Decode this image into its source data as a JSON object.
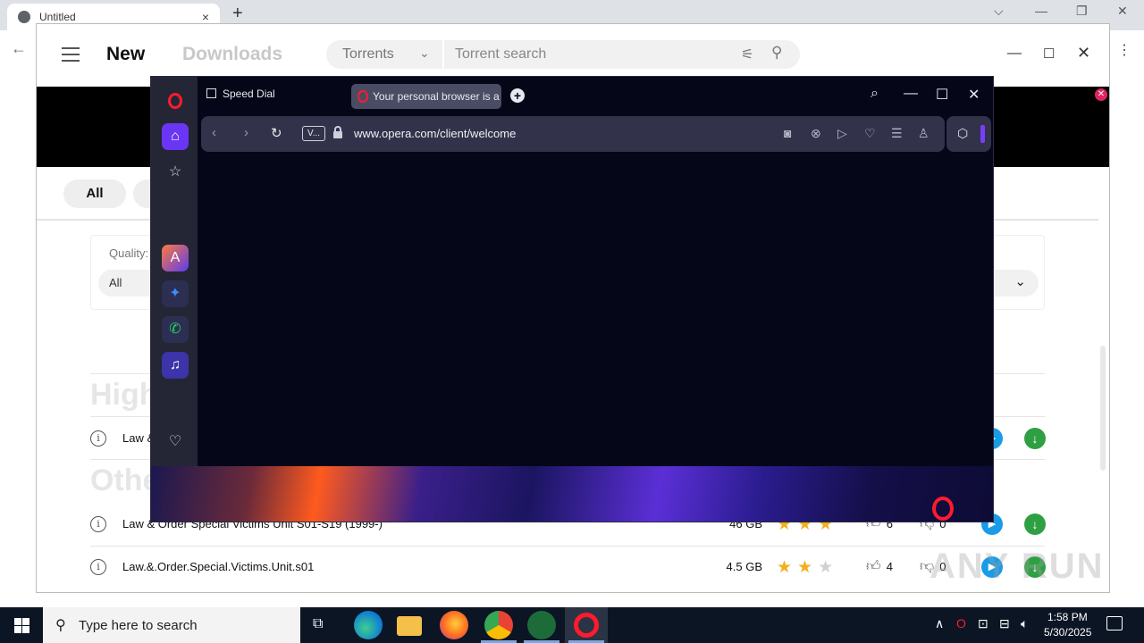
{
  "outer_browser": {
    "tab_title": "Untitled",
    "tab_close": "×",
    "new_tab": "+",
    "win_controls": {
      "dropdown": "⌵",
      "minimize": "—",
      "restore": "❐",
      "close": "✕"
    },
    "back": "←",
    "menu": "⋮"
  },
  "app": {
    "nav": {
      "new": "New",
      "downloads": "Downloads"
    },
    "search": {
      "category": "Torrents",
      "placeholder": "Torrent search"
    },
    "window": {
      "minimize": "—",
      "maximize": "☐",
      "close": "✕"
    },
    "chips": {
      "all": "All"
    },
    "quality": {
      "label": "Quality:",
      "value": "All"
    },
    "sections": {
      "high": "High",
      "other": "Other"
    },
    "rows": [
      {
        "name": "Law &",
        "size": "",
        "stars": 0,
        "likes": "",
        "dislikes": ""
      },
      {
        "name": "Law & Order Special Victims Unit S01-S19 (1999-)",
        "size": "46 GB",
        "stars": 3,
        "likes": "6",
        "dislikes": "0"
      },
      {
        "name": "Law.&.Order.Special.Victims.Unit.s01",
        "size": "4.5 GB",
        "stars": 2,
        "likes": "4",
        "dislikes": "0"
      }
    ],
    "accent_colors": {
      "play": "#1a9be6",
      "download": "#2ea043",
      "star": "#f2b01e"
    }
  },
  "opera": {
    "tabs": [
      {
        "label": "Speed Dial"
      },
      {
        "label": "Your personal browser is a"
      }
    ],
    "url": "www.opera.com/client/welcome",
    "addr_badge": "V...",
    "controls": {
      "search": "⌕",
      "minimize": "—",
      "maximize": "☐",
      "close": "✕"
    },
    "sidebar_icons": [
      "home-icon",
      "bookmarks-icon",
      "aria-icon",
      "messenger-icon",
      "whatsapp-icon",
      "music-icon",
      "heart-icon"
    ],
    "brand_color": "#ff1b2d"
  },
  "taskbar": {
    "search_placeholder": "Type here to search",
    "time": "1:58 PM",
    "date": "5/30/2025"
  },
  "watermark": "ANY RUN"
}
